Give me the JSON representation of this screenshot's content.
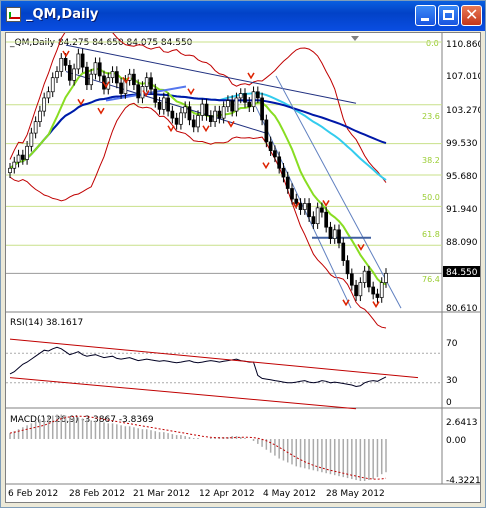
{
  "window": {
    "title": "_QM,Daily",
    "symbol_header": "_QM,Daily  84.275 84.650 84.075 84.550",
    "last_price": "84.550"
  },
  "price_axis": {
    "ticks": [
      "110.860",
      "107.010",
      "103.270",
      "99.530",
      "95.680",
      "91.940",
      "88.090",
      "84.550",
      "80.610"
    ]
  },
  "fibo_levels": [
    "0.0",
    "23.6",
    "38.2",
    "50.0",
    "61.8",
    "76.4"
  ],
  "rsi": {
    "label": "RSI(14) 38.1617",
    "ticks": [
      "70",
      "30",
      "0"
    ]
  },
  "macd": {
    "label": "MACD(12,26,9) -3.3867 -3.8369",
    "ticks": [
      "2.6413",
      "0.00",
      "-4.3221"
    ]
  },
  "time_axis": {
    "labels": [
      "6 Feb 2012",
      "28 Feb 2012",
      "21 Mar 2012",
      "12 Apr 2012",
      "4 May 2012",
      "28 May 2012"
    ]
  },
  "chart_data": {
    "type": "candlestick",
    "title": "_QM,Daily",
    "ylim": [
      80.61,
      110.86
    ],
    "last_bar": {
      "open": 84.275,
      "high": 84.65,
      "low": 84.075,
      "close": 84.55
    },
    "closes": [
      96.5,
      97.2,
      98.0,
      97.5,
      99.0,
      100.5,
      101.8,
      103.0,
      104.5,
      105.2,
      106.8,
      107.5,
      109.0,
      108.2,
      106.5,
      107.8,
      109.5,
      108.0,
      106.0,
      107.2,
      108.5,
      107.0,
      105.5,
      106.8,
      107.5,
      106.2,
      105.0,
      106.5,
      107.2,
      106.0,
      104.5,
      105.8,
      106.8,
      105.5,
      104.0,
      103.2,
      104.5,
      103.0,
      102.2,
      101.5,
      102.8,
      103.5,
      102.0,
      101.2,
      102.5,
      103.8,
      102.5,
      101.8,
      103.0,
      102.2,
      103.5,
      104.2,
      103.0,
      104.5,
      105.0,
      104.0,
      103.5,
      105.2,
      104.5,
      102.0,
      99.5,
      98.5,
      97.8,
      96.5,
      95.5,
      94.2,
      93.0,
      92.5,
      91.8,
      92.5,
      91.0,
      90.2,
      92.0,
      91.5,
      89.8,
      88.5,
      89.5,
      88.0,
      86.0,
      84.5,
      83.2,
      82.0,
      83.5,
      84.8,
      83.0,
      82.2,
      81.8,
      83.5,
      84.55
    ],
    "rsi": [
      42,
      45,
      50,
      55,
      58,
      62,
      66,
      70,
      74,
      73,
      76,
      78,
      76,
      72,
      68,
      70,
      72,
      68,
      66,
      67,
      68,
      66,
      64,
      65,
      66,
      63,
      62,
      63,
      64,
      62,
      60,
      61,
      62,
      61,
      60,
      59,
      60,
      59,
      58,
      57,
      58,
      59,
      60,
      58,
      57,
      58,
      59,
      60,
      59,
      58,
      59,
      60,
      61,
      62,
      60,
      59,
      58,
      58,
      40,
      36,
      35,
      34,
      33,
      32,
      31,
      30,
      30,
      31,
      32,
      33,
      31,
      30,
      31,
      33,
      32,
      30,
      31,
      30,
      29,
      28,
      27,
      25,
      26,
      30,
      32,
      33,
      32,
      35,
      38
    ],
    "macd": [
      0.6,
      0.8,
      1.0,
      1.2,
      1.4,
      1.6,
      1.8,
      2.0,
      2.2,
      2.3,
      2.4,
      2.5,
      2.5,
      2.4,
      2.3,
      2.2,
      2.2,
      2.1,
      2.0,
      1.9,
      1.9,
      1.8,
      1.7,
      1.6,
      1.6,
      1.5,
      1.4,
      1.3,
      1.3,
      1.2,
      1.1,
      1.0,
      1.0,
      0.9,
      0.8,
      0.7,
      0.7,
      0.6,
      0.5,
      0.4,
      0.4,
      0.3,
      0.2,
      0.1,
      0.1,
      0.0,
      0.0,
      0.1,
      0.1,
      0.2,
      0.2,
      0.2,
      0.3,
      0.3,
      0.2,
      0.1,
      0.0,
      -0.2,
      -0.5,
      -0.8,
      -1.1,
      -1.4,
      -1.7,
      -2.0,
      -2.2,
      -2.4,
      -2.6,
      -2.8,
      -2.9,
      -3.0,
      -3.1,
      -3.2,
      -3.3,
      -3.4,
      -3.5,
      -3.6,
      -3.7,
      -3.8,
      -3.9,
      -4.0,
      -4.1,
      -4.2,
      -4.3,
      -4.3,
      -4.2,
      -4.1,
      -3.9,
      -3.6,
      -3.4
    ]
  }
}
